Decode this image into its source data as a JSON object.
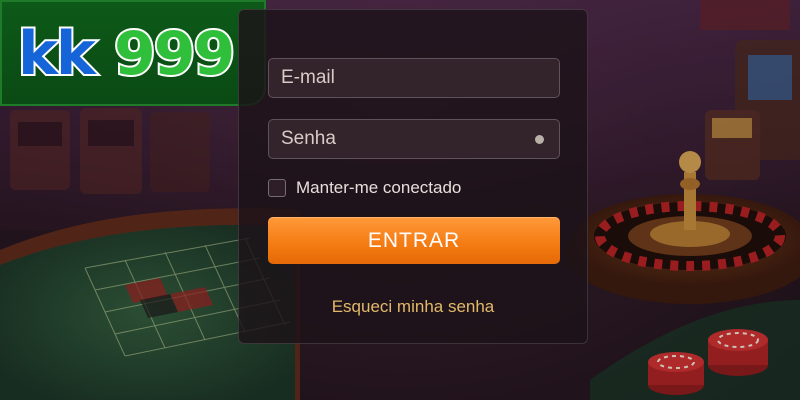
{
  "logo": {
    "part1": "kk",
    "part2": "999",
    "part1_color": "#1565d8",
    "part2_color": "#2fbf3a",
    "background": "#0a4a14"
  },
  "login_form": {
    "email_placeholder": "E-mail",
    "password_placeholder": "Senha",
    "remember_label": "Manter-me conectado",
    "remember_checked": false,
    "submit_label": "ENTRAR",
    "forgot_label": "Esqueci minha senha",
    "accent_color": "#f47a12",
    "link_color": "#e2b969"
  },
  "background": {
    "scene": "casino-roulette-table",
    "icons": [
      "roulette-wheel",
      "casino-chips",
      "slot-machine"
    ]
  }
}
